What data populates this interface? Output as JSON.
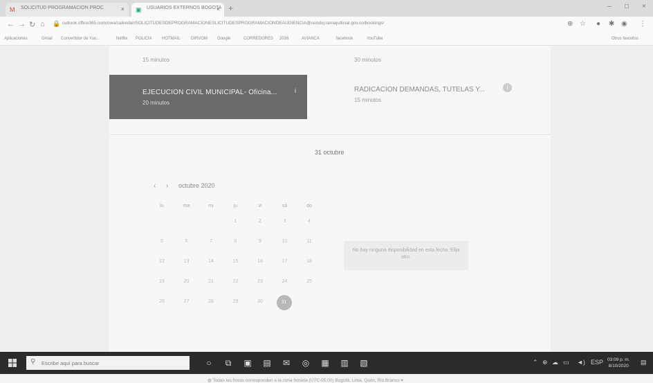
{
  "browser": {
    "tabs": [
      {
        "label": "SOLICITUD PROGRAMACION PROC",
        "icon": "gmail-icon"
      },
      {
        "label": "USUARIOS EXTERNOS BOGOTA",
        "icon": "bookings-icon"
      }
    ],
    "url": "outlook.office365.com/owa/calendar/SOLICITUDESDEPROGRAMACIONESLICITUDESPROGRAMACIONDEAUDIENCIA@cendoj.ramajudicial.gov.co/bookings/",
    "bookmarks": [
      "Aplicaciones",
      "Gmail",
      "Convertidor de Yuo...",
      "Netflix",
      "POLICIA",
      "HOTMAIL",
      "DIRVOM",
      "Google",
      "CORREDORES",
      "2016",
      "AVIANCA",
      "facebook",
      "YouTube",
      "Otros favoritos"
    ]
  },
  "booking": {
    "top_left_duration": "15 minutos",
    "top_right_duration": "30 minutos",
    "service_selected": {
      "name": "EJECUCION CIVIL MUNICIPAL- Oficina...",
      "duration": "20 minutos"
    },
    "service_other": {
      "name": "RADICACION DEMANDAS, TUTELAS Y...",
      "duration": "15 minutos"
    },
    "date_heading": "31 octubre",
    "calendar": {
      "month_label": "octubre 2020",
      "weekdays": [
        "lu",
        "ma",
        "mi",
        "ju",
        "vi",
        "sá",
        "do"
      ],
      "weeks": [
        [
          "",
          "",
          "",
          "1",
          "2",
          "3",
          "4"
        ],
        [
          "5",
          "6",
          "7",
          "8",
          "9",
          "10",
          "11"
        ],
        [
          "12",
          "13",
          "14",
          "15",
          "16",
          "17",
          "18"
        ],
        [
          "19",
          "20",
          "21",
          "22",
          "23",
          "24",
          "25"
        ],
        [
          "26",
          "27",
          "28",
          "29",
          "30",
          "31",
          ""
        ]
      ],
      "selected_day": "31"
    },
    "no_availability": "No hay ninguna disponibilidad en esta fecha. Elija otro.",
    "timezone_note": "Todas las horas corresponden a la zona horaria (UTC-05:00) Bogotá, Lima, Quito, Rio Branco"
  },
  "taskbar": {
    "search_placeholder": "Escribe aquí para buscar",
    "clock_time": "03:09 p. m.",
    "clock_date": "8/10/2020",
    "language": "ESP"
  }
}
